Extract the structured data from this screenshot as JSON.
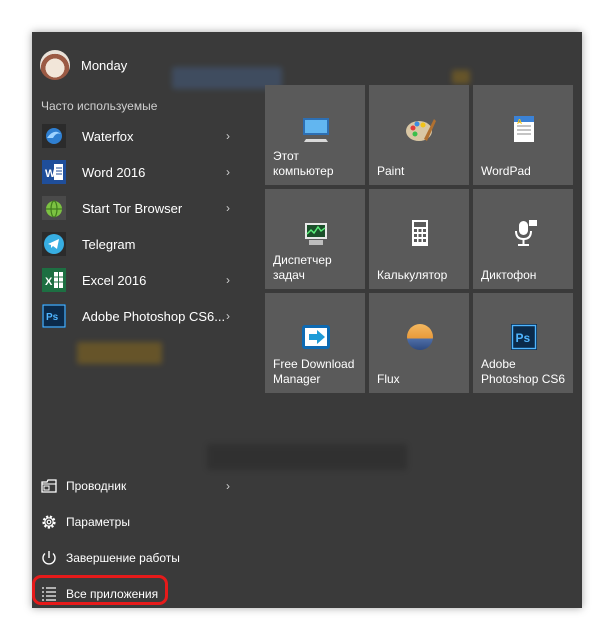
{
  "user": {
    "name": "Monday"
  },
  "section_title": "Часто используемые",
  "apps": [
    {
      "label": "Waterfox",
      "icon": "waterfox-icon",
      "has_submenu": true
    },
    {
      "label": "Word 2016",
      "icon": "word-icon",
      "has_submenu": true
    },
    {
      "label": "Start Tor Browser",
      "icon": "tor-browser-icon",
      "has_submenu": true
    },
    {
      "label": "Telegram",
      "icon": "telegram-icon",
      "has_submenu": false
    },
    {
      "label": "Excel 2016",
      "icon": "excel-icon",
      "has_submenu": true
    },
    {
      "label": "Adobe Photoshop CS6...",
      "icon": "photoshop-icon",
      "has_submenu": true
    }
  ],
  "tiles": [
    {
      "label": "Этот\nкомпьютер",
      "icon": "computer-icon"
    },
    {
      "label": "Paint",
      "icon": "paint-icon"
    },
    {
      "label": "WordPad",
      "icon": "wordpad-icon"
    },
    {
      "label": "Диспетчер\nзадач",
      "icon": "task-manager-icon"
    },
    {
      "label": "Калькулятор",
      "icon": "calculator-icon"
    },
    {
      "label": "Диктофон",
      "icon": "microphone-icon"
    },
    {
      "label": "Free Download\nManager",
      "icon": "fdm-icon"
    },
    {
      "label": "Flux",
      "icon": "flux-icon"
    },
    {
      "label": "Adobe\nPhotoshop CS6",
      "icon": "photoshop-icon"
    }
  ],
  "bottom": [
    {
      "label": "Проводник",
      "icon": "explorer-icon",
      "has_submenu": true
    },
    {
      "label": "Параметры",
      "icon": "gear-icon",
      "has_submenu": false
    },
    {
      "label": "Завершение работы",
      "icon": "power-icon",
      "has_submenu": false
    },
    {
      "label": "Все приложения",
      "icon": "all-apps-icon",
      "has_submenu": false
    }
  ],
  "colors": {
    "menu_bg": "#3a3a3a",
    "tile_bg": "#5a5a5a",
    "highlight": "#e61a1a",
    "text": "#ffffff"
  }
}
